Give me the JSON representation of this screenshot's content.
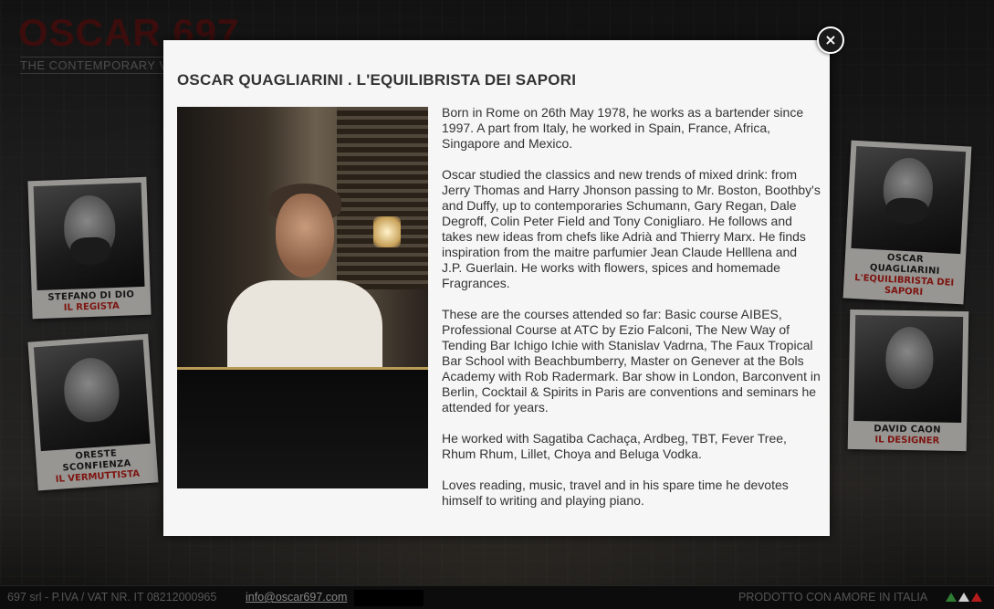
{
  "site": {
    "logo": "OSCAR.697",
    "tagline": "THE CONTEMPORARY V"
  },
  "polaroids": [
    {
      "name": "STEFANO DI DIO",
      "role": "IL REGISTA"
    },
    {
      "name": "ORESTE SCONFIENZA",
      "role": "IL VERMUTTISTA"
    },
    {
      "name": "OSCAR QUAGLIARINI",
      "role": "L'EQUILIBRISTA DEI SAPORI"
    },
    {
      "name": "DAVID CAON",
      "role": "IL DESIGNER"
    }
  ],
  "modal": {
    "title": "OSCAR QUAGLIARINI . L'EQUILIBRISTA DEI SAPORI",
    "close_label": "×",
    "paragraphs": [
      "Born in Rome on 26th May 1978, he works as a bartender since 1997. A part from Italy, he worked in Spain, France, Africa, Singapore and Mexico.",
      "Oscar studied the classics and new trends of mixed drink: from Jerry Thomas and Harry Jhonson passing to Mr. Boston, Boothby's and Duffy, up to contemporaries Schumann, Gary Regan, Dale Degroff, Colin Peter Field and Tony Conigliaro. He follows and takes new ideas from chefs like Adrià and Thierry Marx. He finds inspiration from the maitre parfumier Jean Claude Helllena and J.P. Guerlain. He works with flowers, spices and homemade Fragrances.",
      "These are the courses attended so far: Basic course AIBES, Professional Course at ATC by Ezio Falconi, The New Way of Tending Bar Ichigo Ichie with Stanislav Vadrna, The Faux Tropical Bar School with Beachbumberry, Master on Genever at the Bols Academy with Rob Radermark. Bar show in London, Barconvent in Berlin, Cocktail & Spirits in Paris are conventions and seminars he attended for years.",
      "He worked with Sagatiba Cachaça, Ardbeg, TBT, Fever Tree, Rhum Rhum, Lillet, Choya and Beluga Vodka.",
      "Loves reading, music, travel and in his spare time he devotes himself to writing and playing piano."
    ]
  },
  "footer": {
    "company": "697 srl - P.IVA / VAT NR. IT 08212000965",
    "email": "info@oscar697.com",
    "slogan": "PRODOTTO CON AMORE IN ITALIA",
    "colors": {
      "green": "#2e7d32",
      "white": "#dddddd",
      "red": "#b71c1c"
    }
  }
}
